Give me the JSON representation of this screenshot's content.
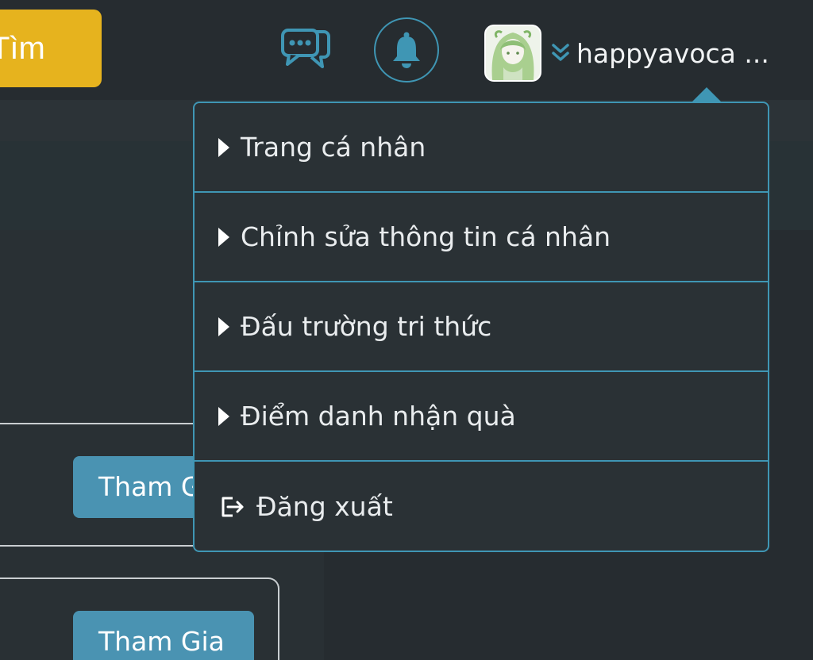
{
  "header": {
    "search_label": "Tìm",
    "username": "happyavoca ...",
    "icons": {
      "chat": "chat-bubbles-icon",
      "bell": "bell-icon",
      "chevron": "double-chevron-down-icon"
    }
  },
  "dropdown": {
    "items": [
      {
        "label": "Trang cá nhân",
        "icon": "caret-right-icon"
      },
      {
        "label": "Chỉnh sửa thông tin cá nhân",
        "icon": "caret-right-icon"
      },
      {
        "label": "Đấu trường tri thức",
        "icon": "caret-right-icon"
      },
      {
        "label": "Điểm danh nhận quà",
        "icon": "caret-right-icon"
      },
      {
        "label": "Đăng xuất",
        "icon": "logout-icon"
      }
    ]
  },
  "list": {
    "join_labels": [
      "Tham Gia",
      "Tham Gia"
    ]
  },
  "colors": {
    "accent": "#3f96b4",
    "search_button": "#e6b31e",
    "join_button": "#4a93b2",
    "background": "#262c30"
  }
}
